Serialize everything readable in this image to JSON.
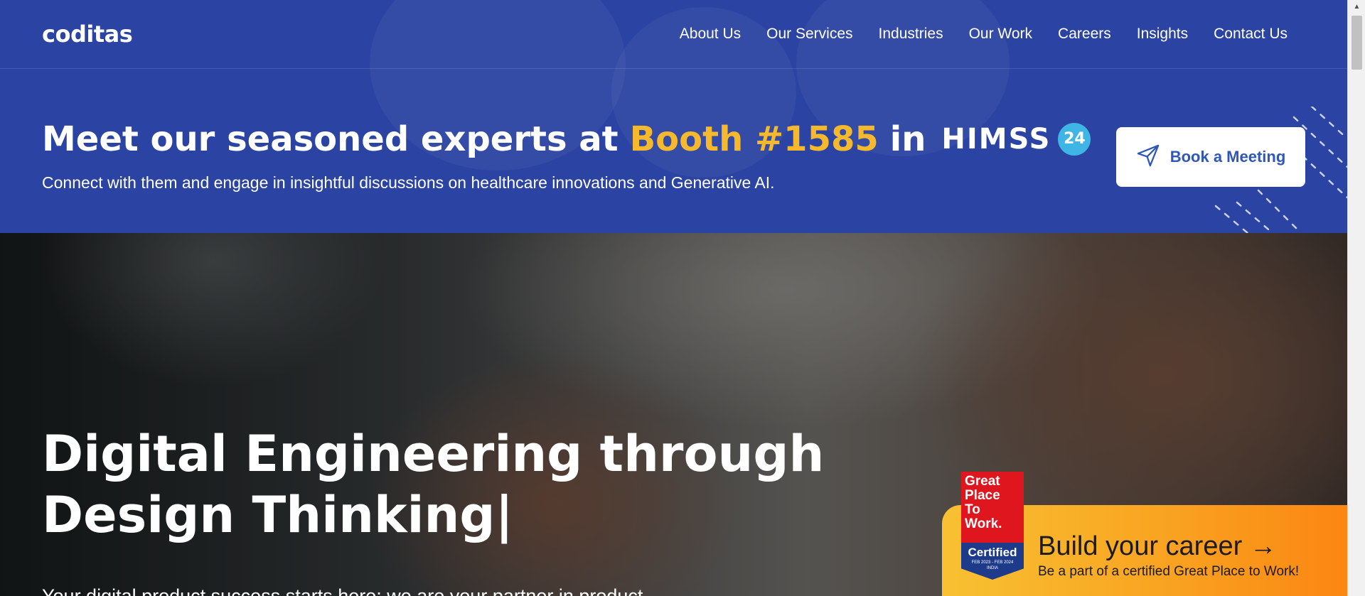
{
  "brand": {
    "logo_text": "coditas"
  },
  "nav": {
    "items": [
      {
        "label": "About Us"
      },
      {
        "label": "Our Services"
      },
      {
        "label": "Industries"
      },
      {
        "label": "Our Work"
      },
      {
        "label": "Careers"
      },
      {
        "label": "Insights"
      },
      {
        "label": "Contact Us"
      }
    ]
  },
  "banner": {
    "headline_prefix": "Meet our seasoned experts at",
    "headline_highlight": "Booth #1585",
    "headline_in": "in",
    "event_logo_text": "HIMSS",
    "event_year_badge": "24",
    "subtext": "Connect with them and engage in insightful discussions on healthcare innovations and Generative AI.",
    "cta_label": "Book a Meeting",
    "cta_icon": "paper-plane-icon"
  },
  "hero": {
    "title_line1": "Digital Engineering through",
    "title_line2": "Design Thinking|",
    "subtitle": "Your digital product success starts here; we are your partner in product"
  },
  "career_promo": {
    "title": "Build your career →",
    "subtitle": "Be a part of a certified Great Place to Work!",
    "badge_lines": [
      "Great",
      "Place",
      "To",
      "Work."
    ],
    "badge_certified": "Certified",
    "badge_dates": "FEB 2023 - FEB 2024",
    "badge_country": "INDIA"
  },
  "colors": {
    "nav_bg": "#2b44a3",
    "highlight": "#f6b82c",
    "cta_text": "#2f57b8",
    "career_gradient_start": "#f8c132",
    "career_gradient_end": "#fb8612",
    "badge_red": "#e0161e",
    "badge_blue": "#1e3a8a"
  }
}
